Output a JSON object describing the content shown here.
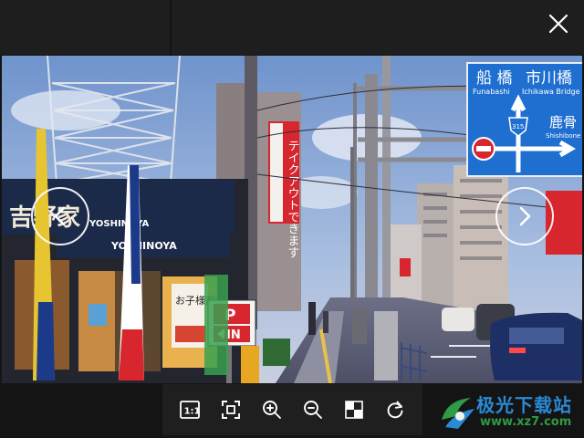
{
  "toolbar": {
    "items": [
      {
        "name": "actual-size-button",
        "icon": "one-to-one-icon",
        "label": "1:1"
      },
      {
        "name": "fit-window-button",
        "icon": "fit-to-window-icon"
      },
      {
        "name": "zoom-in-button",
        "icon": "zoom-in-icon"
      },
      {
        "name": "zoom-out-button",
        "icon": "zoom-out-icon"
      },
      {
        "name": "transparency-button",
        "icon": "checkerboard-icon"
      },
      {
        "name": "rotate-button",
        "icon": "rotate-clockwise-icon"
      }
    ]
  },
  "navigation": {
    "prev_icon": "chevron-left-icon",
    "next_icon": "chevron-right-icon"
  },
  "close_icon": "close-icon",
  "photo": {
    "sign_top_left_jp": "船 橋",
    "sign_top_left_en": "Funabashi",
    "sign_top_right_jp": "市川橋",
    "sign_top_right_en": "Ichikawa Bridge",
    "sign_route": "315",
    "sign_right_jp": "鹿骨",
    "sign_right_en": "Shishibone",
    "shop_name": "YOSHINOYA",
    "shop_jp": "吉野家",
    "banner_text": "テイクアウトできます",
    "parking_p": "P",
    "parking_in": "IN",
    "poster_text": "お子様割引"
  },
  "watermark": {
    "title": "极光下载站",
    "url": "www.xz7.com"
  },
  "colors": {
    "sign_blue": "#1f6fd0",
    "shop_navy": "#1c2a4a",
    "banner_red": "#d7262e"
  }
}
